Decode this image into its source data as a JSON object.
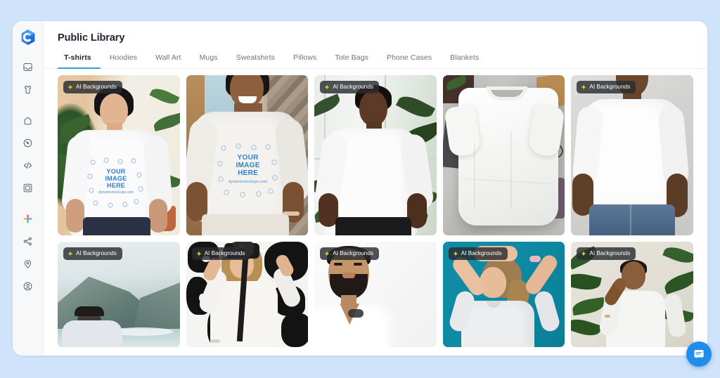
{
  "theme": {
    "page_background": "#cfe4fb",
    "app_background": "#ffffff",
    "sidebar_background": "#f7f8fa",
    "accent": "#2f9fd8",
    "chat_accent": "#1f8ded",
    "badge_background": "#292c30",
    "print_blue": "#2a7fd4"
  },
  "sidebar": {
    "logo": {
      "name": "dynamic-mockups-logo",
      "color": "#1f7ae0"
    },
    "items": [
      {
        "icon": "inbox-icon",
        "label": "Inbox"
      },
      {
        "icon": "tshirt-icon",
        "label": "Apparel"
      },
      {
        "icon": "bag-icon",
        "label": "Bags"
      },
      {
        "icon": "target-icon",
        "label": "Smart Objects"
      },
      {
        "icon": "code-icon",
        "label": "API"
      },
      {
        "icon": "frame-icon",
        "label": "Frames"
      },
      {
        "icon": "apps-icon",
        "label": "Integrations"
      },
      {
        "icon": "share-icon",
        "label": "Share"
      },
      {
        "icon": "location-icon",
        "label": "Location"
      },
      {
        "icon": "account-icon",
        "label": "Account"
      }
    ]
  },
  "header": {
    "title": "Public Library"
  },
  "tabs": [
    {
      "label": "T-shirts",
      "active": true
    },
    {
      "label": "Hoodies",
      "active": false
    },
    {
      "label": "Wall Art",
      "active": false
    },
    {
      "label": "Mugs",
      "active": false
    },
    {
      "label": "Sweatshirts",
      "active": false
    },
    {
      "label": "Pillows",
      "active": false
    },
    {
      "label": "Tote Bags",
      "active": false
    },
    {
      "label": "Phone Cases",
      "active": false
    },
    {
      "label": "Blankets",
      "active": false
    }
  ],
  "badge": {
    "label": "AI Backgrounds",
    "icon": "sparkle-icon",
    "icon_color": "#d7e33a"
  },
  "print": {
    "line1": "YOUR",
    "line2": "IMAGE",
    "line3": "HERE",
    "url": "dynamicmockups.com"
  },
  "cards": [
    {
      "id": "card-1",
      "row": 1,
      "badge": true,
      "scene": "asian-man-plants",
      "print": true,
      "alt": "Man in white t-shirt with YOUR IMAGE HERE print, plants background"
    },
    {
      "id": "card-2",
      "row": 1,
      "badge": false,
      "scene": "black-man-beach-hut",
      "print": true,
      "alt": "Smiling man in white t-shirt with print, beach hut background"
    },
    {
      "id": "card-3",
      "row": 1,
      "badge": true,
      "scene": "black-man-window",
      "print": false,
      "alt": "Man in plain white t-shirt by a bright window with plants"
    },
    {
      "id": "card-4",
      "row": 1,
      "badge": false,
      "scene": "flatlay-tshirt",
      "print": false,
      "alt": "Flat lay blank white t-shirt on concrete"
    },
    {
      "id": "card-5",
      "row": 1,
      "badge": true,
      "scene": "man-jeans-grey",
      "print": false,
      "alt": "Man in white t-shirt and jeans on grey background"
    },
    {
      "id": "card-6",
      "row": 2,
      "badge": true,
      "scene": "cliff-beach",
      "print": false,
      "alt": "Man with cap looking at sea cliffs"
    },
    {
      "id": "card-7",
      "row": 2,
      "badge": true,
      "scene": "woman-camera-map",
      "print": false,
      "alt": "Woman with camera in front of a world map wall"
    },
    {
      "id": "card-8",
      "row": 2,
      "badge": true,
      "scene": "bearded-man-white",
      "print": false,
      "alt": "Bearded man in white v-neck on white background"
    },
    {
      "id": "card-9",
      "row": 2,
      "badge": true,
      "scene": "woman-teal",
      "print": false,
      "alt": "Woman tying hair on teal background"
    },
    {
      "id": "card-10",
      "row": 2,
      "badge": true,
      "scene": "man-plant-beige",
      "print": false,
      "alt": "Man sitting thoughtfully beside a plant"
    }
  ],
  "chat": {
    "icon": "chat-bubble-icon",
    "label": "Open messenger"
  }
}
